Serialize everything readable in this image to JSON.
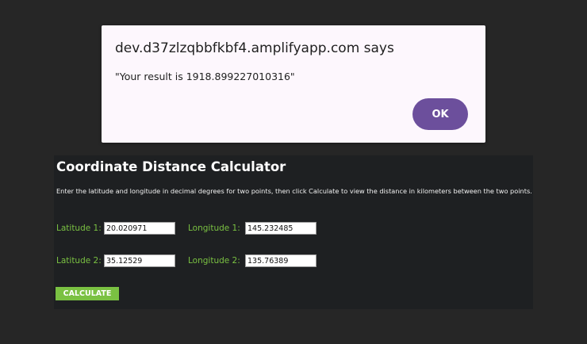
{
  "alert": {
    "origin": "dev.d37zlzqbbfkbf4.amplifyapp.com says",
    "message": "\"Your result is 1918.899227010316\"",
    "ok_label": "OK"
  },
  "calculator": {
    "title": "Coordinate Distance Calculator",
    "description": "Enter the latitude and longitude in decimal degrees for two points, then click Calculate to view the distance in kilometers between the two points.",
    "point1": {
      "lat_label": "Latitude 1:",
      "lat_value": "20.020971",
      "lon_label": "Longitude 1:",
      "lon_value": "145.232485"
    },
    "point2": {
      "lat_label": "Latitude 2:",
      "lat_value": "35.12529",
      "lon_label": "Longitude 2:",
      "lon_value": "135.76389"
    },
    "calculate_label": "CALCULATE"
  },
  "colors": {
    "page_background": "#262626",
    "panel_background": "#1e2022",
    "accent_green": "#7ac142",
    "ok_button": "#6c4f9c",
    "dialog_background": "#fdf7fd"
  }
}
